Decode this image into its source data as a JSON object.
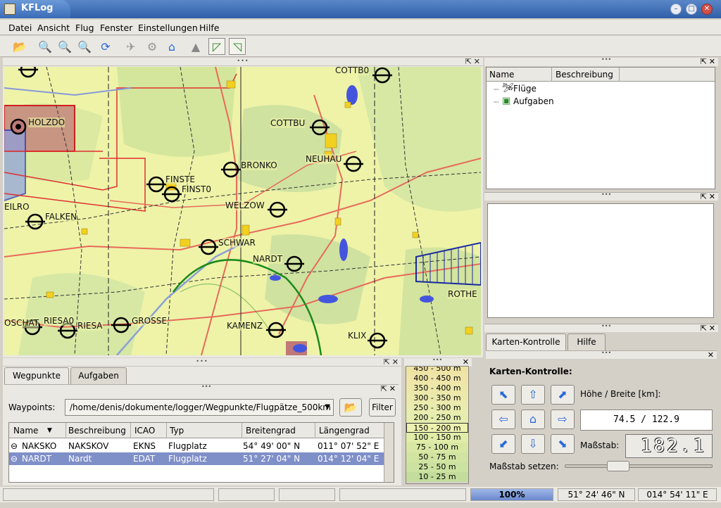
{
  "window": {
    "title": "KFLog"
  },
  "menu": [
    "Datei",
    "Ansicht",
    "Flug",
    "Fenster",
    "Einstellungen",
    "Hilfe"
  ],
  "map": {
    "labels": [
      "HOLZDO",
      "COTTB0",
      "COTTBU",
      "NEUHAU",
      "BRONKO",
      "FINSTE",
      "FINST0",
      "EILRO",
      "FALKEN",
      "WELZOW",
      "SCHWAR",
      "NARDT",
      "ROTHE",
      "OSCHAT",
      "RIESA0",
      "RIESA",
      "GROSSE",
      "KAMENZ",
      "KLIX"
    ]
  },
  "waypoints": {
    "tabs": [
      "Wegpunkte",
      "Aufgaben"
    ],
    "label": "Waypoints:",
    "path": "/home/denis/dokumente/logger/Wegpunkte/Flugpätze_500km",
    "filter_label": "Filter",
    "columns": [
      "Name",
      "Beschreibung",
      "ICAO",
      "Typ",
      "Breitengrad",
      "Längengrad"
    ],
    "rows": [
      {
        "name": "NAKSKO",
        "desc": "NAKSKOV",
        "icao": "EKNS",
        "typ": "Flugplatz",
        "lat": "54° 49' 00\" N",
        "lon": "011° 07' 52\" E"
      },
      {
        "name": "NARDT",
        "desc": "Nardt",
        "icao": "EDAT",
        "typ": "Flugplatz",
        "lat": "51° 27' 04\" N",
        "lon": "014° 12' 04\" E"
      }
    ]
  },
  "scales": [
    "450 - 500 m",
    "400 - 450 m",
    "350 - 400 m",
    "300 - 350 m",
    "250 - 300 m",
    "200 - 250 m",
    "150 - 200 m",
    "100 - 150 m",
    "75 - 100 m",
    "50 - 75 m",
    "25 - 50 m",
    "10 - 25 m"
  ],
  "tree": {
    "columns": [
      "Name",
      "Beschreibung"
    ],
    "items": [
      "Flüge",
      "Aufgaben"
    ]
  },
  "map_control": {
    "tabs": [
      "Karten-Kontrolle",
      "Hilfe"
    ],
    "heading": "Karten-Kontrolle:",
    "size_label": "Höhe / Breite [km]:",
    "size_value": "74.5 / 122.9",
    "scale_label": "Maßstab:",
    "scale_value": "182.1",
    "set_scale_label": "Maßstab setzen:",
    "slider_value": 0.33
  },
  "status": {
    "progress": "100%",
    "lat": "51° 24' 46\" N",
    "lon": "014° 54' 11\" E"
  },
  "colors": {
    "accent": "#2f5fa8",
    "selection": "#7f8fc8",
    "map_base": "#eef3a8"
  }
}
